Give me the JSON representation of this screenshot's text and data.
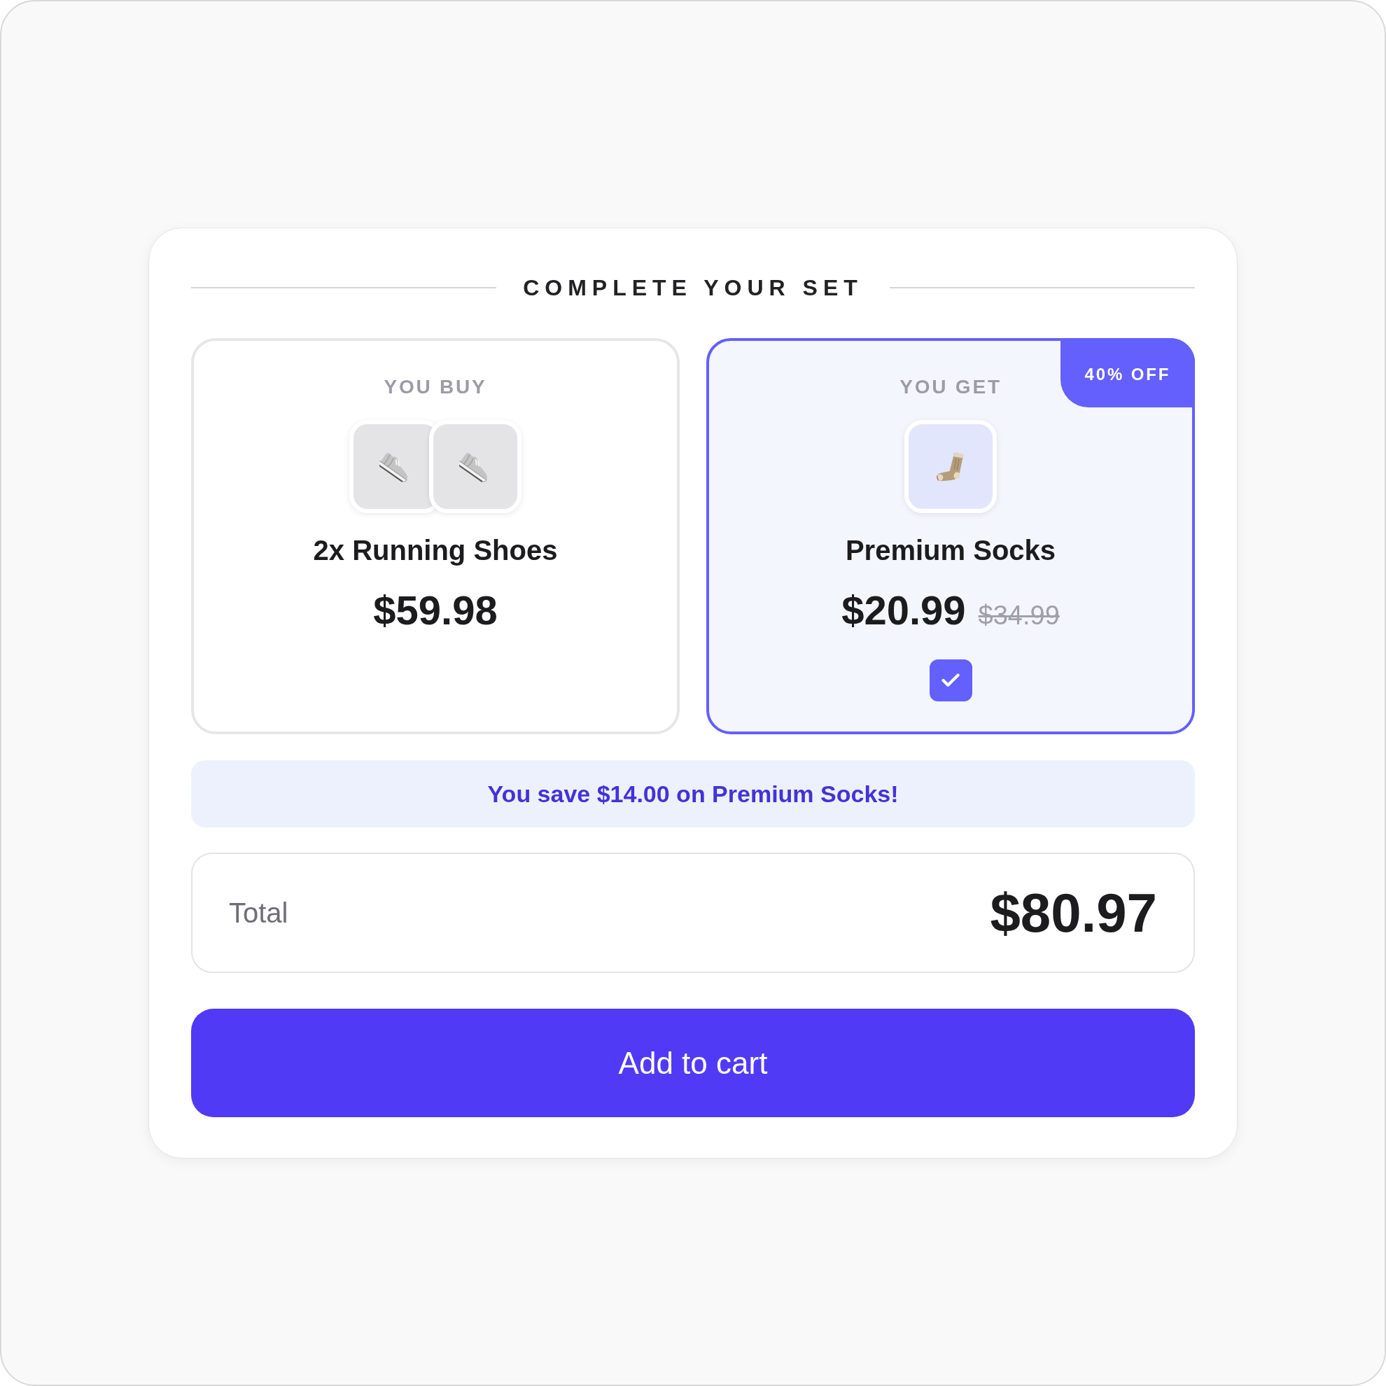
{
  "heading": "COMPLETE YOUR SET",
  "panels": [
    {
      "kind": "buy",
      "label": "YOU BUY",
      "name": "2x Running Shoes",
      "price": "$59.98"
    },
    {
      "kind": "get",
      "label": "YOU GET",
      "badge": "40% OFF",
      "name": "Premium Socks",
      "price": "$20.99",
      "original_price": "$34.99",
      "checked": true
    }
  ],
  "savings": "You save $14.00 on Premium Socks!",
  "total": {
    "label": "Total",
    "amount": "$80.97"
  },
  "button": "Add to cart"
}
